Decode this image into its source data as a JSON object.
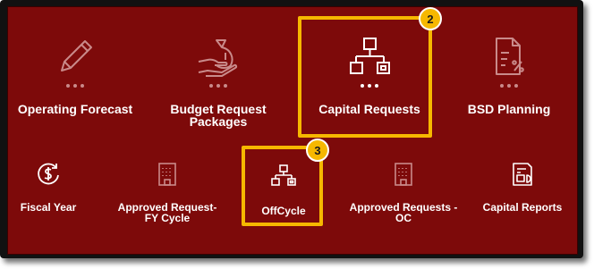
{
  "row1": [
    {
      "label": "Operating Forecast",
      "icon": "pencil-icon"
    },
    {
      "label": "Budget Request Packages",
      "icon": "hand-money-bag-icon"
    },
    {
      "label": "Capital Requests",
      "icon": "hierarchy-icon"
    },
    {
      "label": "BSD Planning",
      "icon": "document-percent-icon"
    }
  ],
  "row2": [
    {
      "label": "Fiscal Year",
      "icon": "dollar-cycle-icon"
    },
    {
      "label": "Approved Request- FY Cycle",
      "icon": "building-icon"
    },
    {
      "label": "OffCycle",
      "icon": "hierarchy-icon"
    },
    {
      "label": "Approved Requests - OC",
      "icon": "building-icon"
    },
    {
      "label": "Capital Reports",
      "icon": "report-chart-icon"
    }
  ],
  "callouts": [
    {
      "number": "2",
      "target": "Capital Requests"
    },
    {
      "number": "3",
      "target": "OffCycle"
    }
  ],
  "colors": {
    "panel": "#7d0a0a",
    "highlight": "#f6b800",
    "frame": "#111111"
  }
}
